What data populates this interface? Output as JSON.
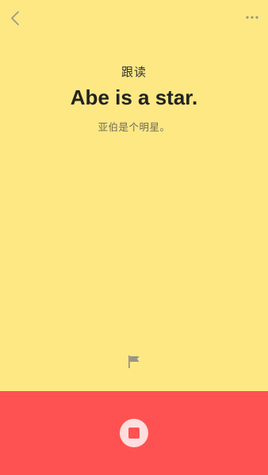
{
  "header": {
    "back_icon": "chevron-left-icon",
    "more_icon": "more-horizontal-icon"
  },
  "practice": {
    "mode_label": "跟读",
    "sentence": "Abe is a star.",
    "translation": "亚伯是个明星。"
  },
  "flag": {
    "icon": "flag-icon"
  },
  "recorder": {
    "stop_icon": "stop-icon",
    "state": "recording"
  },
  "colors": {
    "background": "#fde884",
    "recorder_panel": "#fe5252",
    "stop_button": "#ffdede",
    "icon_gray": "#9a9585"
  }
}
